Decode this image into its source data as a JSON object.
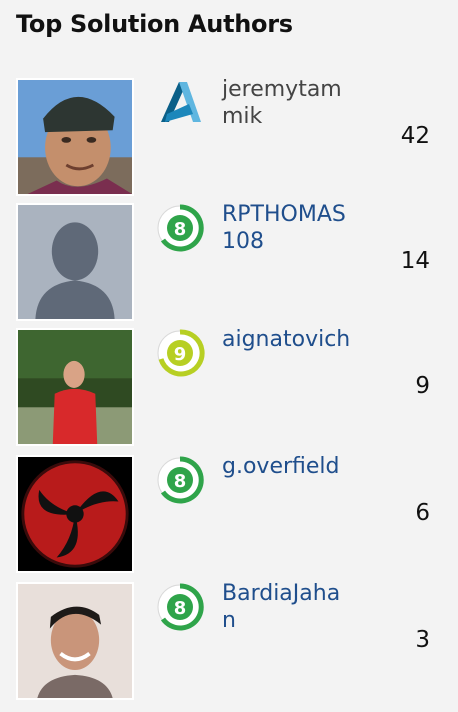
{
  "title": "Top Solution Authors",
  "badge_colors": {
    "autodesk_a_dark": "#0a5f88",
    "autodesk_a_light": "#5fb6e0",
    "level8_ring": "#2fa44a",
    "level9_ring": "#b7cf23"
  },
  "authors": [
    {
      "name": "jeremytammik",
      "badge": "autodesk-logo-icon",
      "solutions": "42"
    },
    {
      "name": "RPTHOMAS108",
      "badge": "level-8-badge-icon",
      "badge_level": "8",
      "solutions": "14"
    },
    {
      "name": "aignatovich",
      "badge": "level-9-badge-icon",
      "badge_level": "9",
      "solutions": "9"
    },
    {
      "name": "g.overfield",
      "badge": "level-8-badge-icon",
      "badge_level": "8",
      "solutions": "6"
    },
    {
      "name": "BardiaJahan",
      "badge": "level-8-badge-icon",
      "badge_level": "8",
      "solutions": "3"
    }
  ]
}
